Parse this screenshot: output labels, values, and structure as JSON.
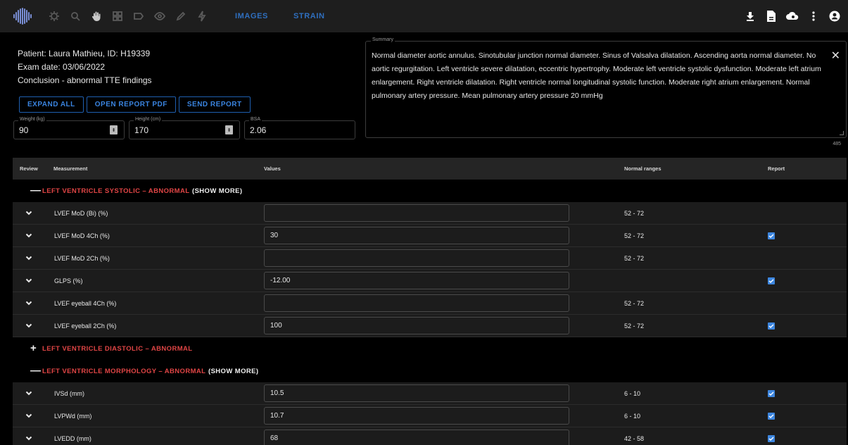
{
  "toolbar": {
    "tabs": [
      "IMAGES",
      "STRAIN"
    ],
    "icons": [
      "logo-icon",
      "contrast-icon",
      "zoom-icon",
      "pan-hand-icon",
      "grid-icon",
      "label-icon",
      "eye-icon",
      "pencil-icon",
      "bolt-icon"
    ],
    "right_icons": [
      "download-icon",
      "document-icon",
      "cloud-search-icon",
      "more-vert-icon",
      "account-icon"
    ]
  },
  "patient": {
    "line1": "Patient: Laura Mathieu, ID: H19339",
    "line2": "Exam date: 03/06/2022",
    "line3": "Conclusion - abnormal TTE findings"
  },
  "buttons": {
    "expand_all": "EXPAND ALL",
    "open_pdf": "OPEN REPORT PDF",
    "send_report": "SEND REPORT"
  },
  "fields": {
    "weight_label": "Weight (kg)",
    "weight_value": "90",
    "height_label": "Height (cm)",
    "height_value": "170",
    "bsa_label": "BSA",
    "bsa_value": "2.06"
  },
  "summary": {
    "label": "Summary",
    "text": "Normal diameter aortic annulus. Sinotubular junction normal diameter. Sinus of Valsalva dilatation. Ascending aorta normal diameter. No aortic regurgitation. Left ventricle severe dilatation, eccentric hypertrophy. Moderate left ventricle systolic dysfunction. Moderate left atrium enlargement. Right ventricle dilatation. Right ventricle normal longitudinal systolic function. Moderate right atrium enlargement. Normal pulmonary artery pressure. Mean pulmonary artery pressure 20 mmHg",
    "char_count": "485"
  },
  "table": {
    "headers": {
      "review": "Review",
      "measurement": "Measurement",
      "values": "Values",
      "ranges": "Normal ranges",
      "report": "Report"
    }
  },
  "sections": [
    {
      "sign": "—",
      "title": "LEFT VENTRICLE SYSTOLIC – ABNORMAL",
      "more": "(SHOW MORE)",
      "rows": [
        {
          "name": "LVEF MoD (Bi) (%)",
          "value": "",
          "range": "52 - 72",
          "report": false
        },
        {
          "name": "LVEF MoD 4Ch (%)",
          "value": "30",
          "range": "52 - 72",
          "report": true
        },
        {
          "name": "LVEF MoD 2Ch (%)",
          "value": "",
          "range": "52 - 72",
          "report": false
        },
        {
          "name": "GLPS (%)",
          "value": "-12.00",
          "range": "",
          "report": true
        },
        {
          "name": "LVEF eyeball 4Ch (%)",
          "value": "",
          "range": "52 - 72",
          "report": false
        },
        {
          "name": "LVEF eyeball 2Ch (%)",
          "value": "100",
          "range": "52 - 72",
          "report": true
        }
      ]
    },
    {
      "sign": "+",
      "title": "LEFT VENTRICLE DIASTOLIC – ABNORMAL",
      "more": "",
      "rows": []
    },
    {
      "sign": "—",
      "title": "LEFT VENTRICLE MORPHOLOGY – ABNORMAL",
      "more": "(SHOW MORE)",
      "rows": [
        {
          "name": "IVSd (mm)",
          "value": "10.5",
          "range": "6 - 10",
          "report": true
        },
        {
          "name": "LVPWd (mm)",
          "value": "10.7",
          "range": "6 - 10",
          "report": true
        },
        {
          "name": "LVEDD (mm)",
          "value": "68",
          "range": "42 - 58",
          "report": true
        }
      ]
    }
  ],
  "colors": {
    "accent_blue": "#2f6fbf",
    "abnormal_red": "#e04545",
    "checkbox_blue": "#3d86df"
  }
}
